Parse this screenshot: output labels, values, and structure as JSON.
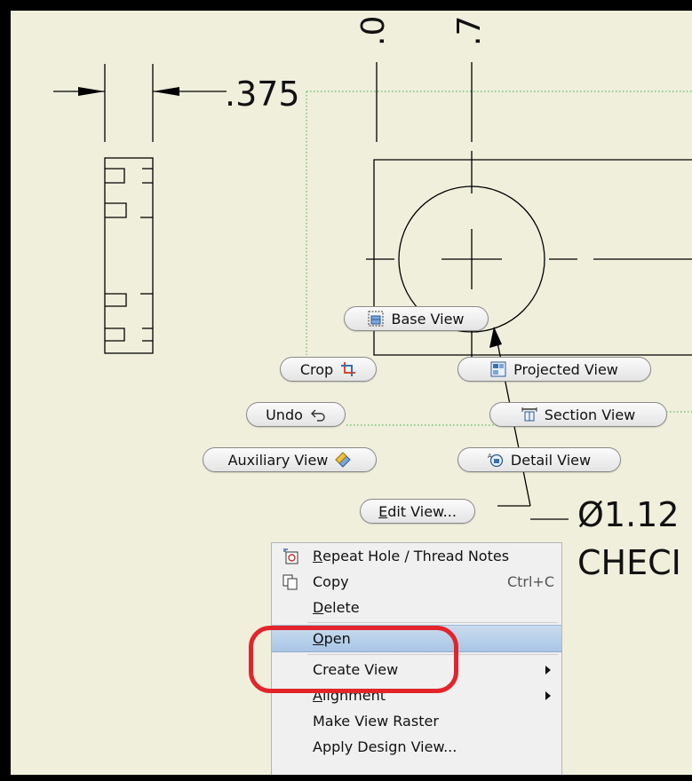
{
  "drawing": {
    "dim_375": ".375",
    "dim_top_left": ".0",
    "dim_top_right": ".7",
    "hole_callout": "Ø1.12",
    "check_text": "CHECI",
    "colors": {
      "sheet": "#efefdc",
      "frame": "#000000",
      "line": "#000000",
      "construction": "#5bb85b"
    }
  },
  "marking_menu": {
    "base_view": "Base View",
    "crop": "Crop",
    "projected_view": "Projected View",
    "undo": "Undo",
    "section_view": "Section View",
    "auxiliary_view": "Auxiliary View",
    "detail_view": "Detail View",
    "edit_view_e": "E",
    "edit_view_rest": "dit View..."
  },
  "context_menu": {
    "items": [
      {
        "mnemonic": "R",
        "rest": "epeat Hole / Thread Notes",
        "shortcut": "",
        "submenu": false,
        "icon": "hole-notes-icon"
      },
      {
        "mnemonic": "",
        "rest": "Copy",
        "shortcut": "Ctrl+C",
        "submenu": false,
        "icon": "copy-icon"
      },
      {
        "mnemonic": "D",
        "rest": "elete",
        "shortcut": "",
        "submenu": false,
        "icon": ""
      },
      {
        "mnemonic": "O",
        "rest": "pen",
        "shortcut": "",
        "submenu": false,
        "icon": "",
        "highlighted": true
      },
      {
        "mnemonic": "",
        "rest": "Create View",
        "shortcut": "",
        "submenu": true,
        "icon": ""
      },
      {
        "mnemonic": "A",
        "rest": "lignment",
        "shortcut": "",
        "submenu": true,
        "icon": ""
      },
      {
        "mnemonic": "",
        "rest": "Make View Raster",
        "shortcut": "",
        "submenu": false,
        "icon": ""
      },
      {
        "mnemonic": "",
        "rest": "Apply Design View...",
        "shortcut": "",
        "submenu": false,
        "icon": ""
      }
    ],
    "highlight_color": "#a9c6e6",
    "annotation_color": "#e3252b"
  }
}
